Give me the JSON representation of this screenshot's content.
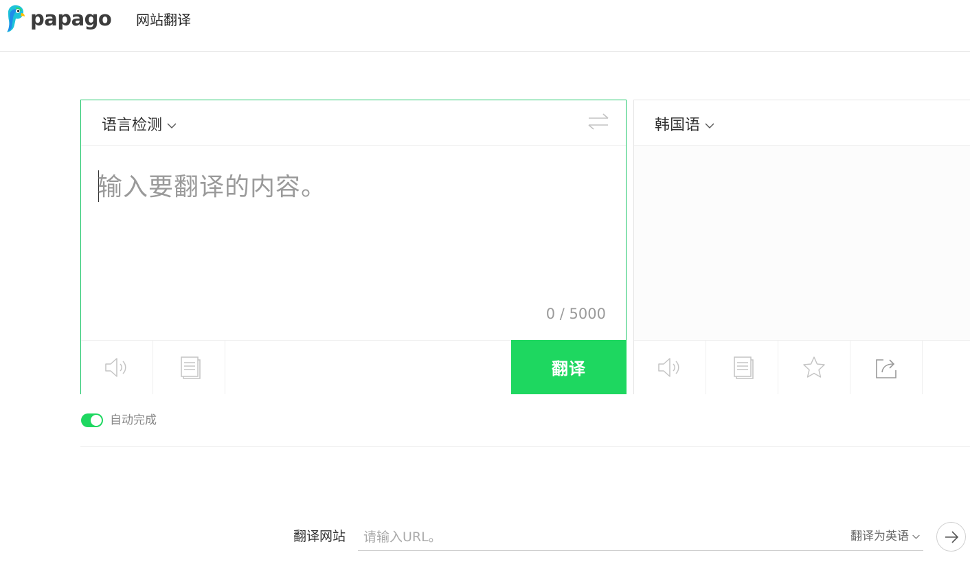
{
  "header": {
    "logo_text": "papago",
    "nav_website": "网站翻译"
  },
  "source": {
    "language": "语言检测",
    "placeholder": "输入要翻译的内容。",
    "counter": "0 / 5000",
    "translate_label": "翻译"
  },
  "target": {
    "language": "韩国语"
  },
  "autocomplete": {
    "label": "自动完成",
    "enabled": true
  },
  "website": {
    "label": "翻译网站",
    "url_placeholder": "请输入URL。",
    "url_value": "",
    "translate_to": "翻译为英语"
  },
  "icons": [
    "parrot-logo-icon",
    "chevron-down-icon",
    "swap-icon",
    "speaker-icon",
    "copy-icon",
    "star-icon",
    "share-icon",
    "arrow-right-icon"
  ],
  "colors": {
    "accent": "#1ed760",
    "border_active": "#1fc76a"
  }
}
